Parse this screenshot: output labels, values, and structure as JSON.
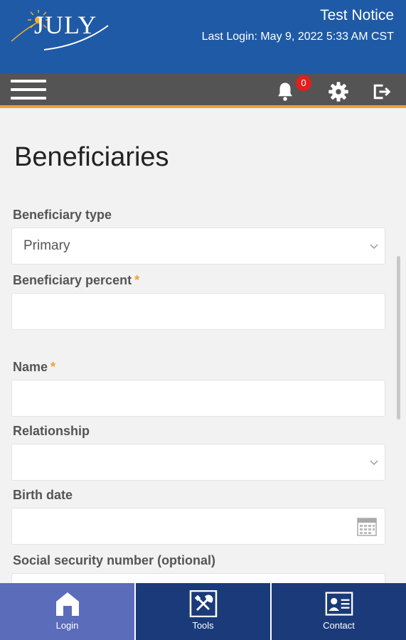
{
  "header": {
    "logo_text": "JULY",
    "notice": "Test Notice",
    "last_login": "Last Login: May 9, 2022 5:33 AM CST"
  },
  "toolbar": {
    "notification_count": "0",
    "icons": [
      "menu-icon",
      "bell-icon",
      "gear-icon",
      "logout-icon"
    ]
  },
  "page": {
    "title": "Beneficiaries"
  },
  "form": {
    "beneficiary_type": {
      "label": "Beneficiary type",
      "value": "Primary"
    },
    "beneficiary_percent": {
      "label": "Beneficiary percent",
      "required": "*",
      "value": ""
    },
    "name": {
      "label": "Name",
      "required": "*",
      "value": ""
    },
    "relationship": {
      "label": "Relationship",
      "value": ""
    },
    "birth_date": {
      "label": "Birth date",
      "value": ""
    },
    "ssn": {
      "label": "Social security number (optional)",
      "value": ""
    }
  },
  "bottom_nav": {
    "items": [
      {
        "label": "Login",
        "icon": "home-icon",
        "active": true
      },
      {
        "label": "Tools",
        "icon": "tools-icon",
        "active": false
      },
      {
        "label": "Contact",
        "icon": "contact-card-icon",
        "active": false
      }
    ]
  },
  "colors": {
    "header_bg": "#1f5aa6",
    "toolbar_bg": "#545454",
    "accent_orange": "#f0a030",
    "badge_red": "#e02020",
    "nav_bg": "#1a3a7a",
    "nav_active_bg": "#5a6cba"
  }
}
